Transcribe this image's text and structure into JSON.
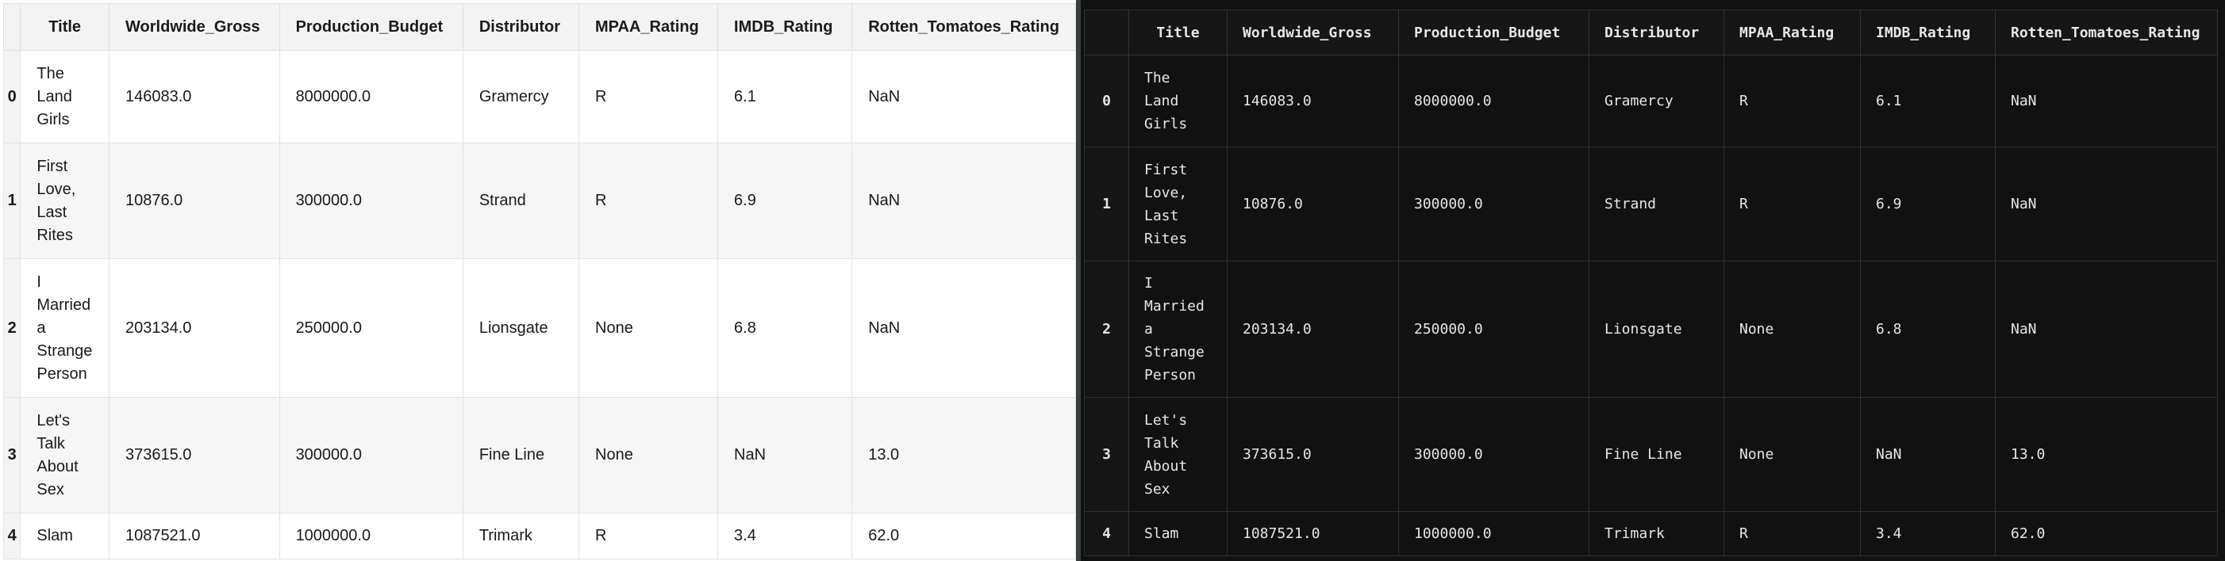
{
  "columns": [
    "",
    "Title",
    "Worldwide_Gross",
    "Production_Budget",
    "Distributor",
    "MPAA_Rating",
    "IMDB_Rating",
    "Rotten_Tomatoes_Rating"
  ],
  "rows": [
    [
      "0",
      "The Land Girls",
      "146083.0",
      "8000000.0",
      "Gramercy",
      "R",
      "6.1",
      "NaN"
    ],
    [
      "1",
      "First Love, Last Rites",
      "10876.0",
      "300000.0",
      "Strand",
      "R",
      "6.9",
      "NaN"
    ],
    [
      "2",
      "I Married a Strange Person",
      "203134.0",
      "250000.0",
      "Lionsgate",
      "None",
      "6.8",
      "NaN"
    ],
    [
      "3",
      "Let's Talk About Sex",
      "373615.0",
      "300000.0",
      "Fine Line",
      "None",
      "NaN",
      "13.0"
    ],
    [
      "4",
      "Slam",
      "1087521.0",
      "1000000.0",
      "Trimark",
      "R",
      "3.4",
      "62.0"
    ]
  ],
  "colors": {
    "light_bg": "#ffffff",
    "light_header": "#f3f3f3",
    "dark_bg": "#111111",
    "dark_text": "#e6e6e6"
  }
}
